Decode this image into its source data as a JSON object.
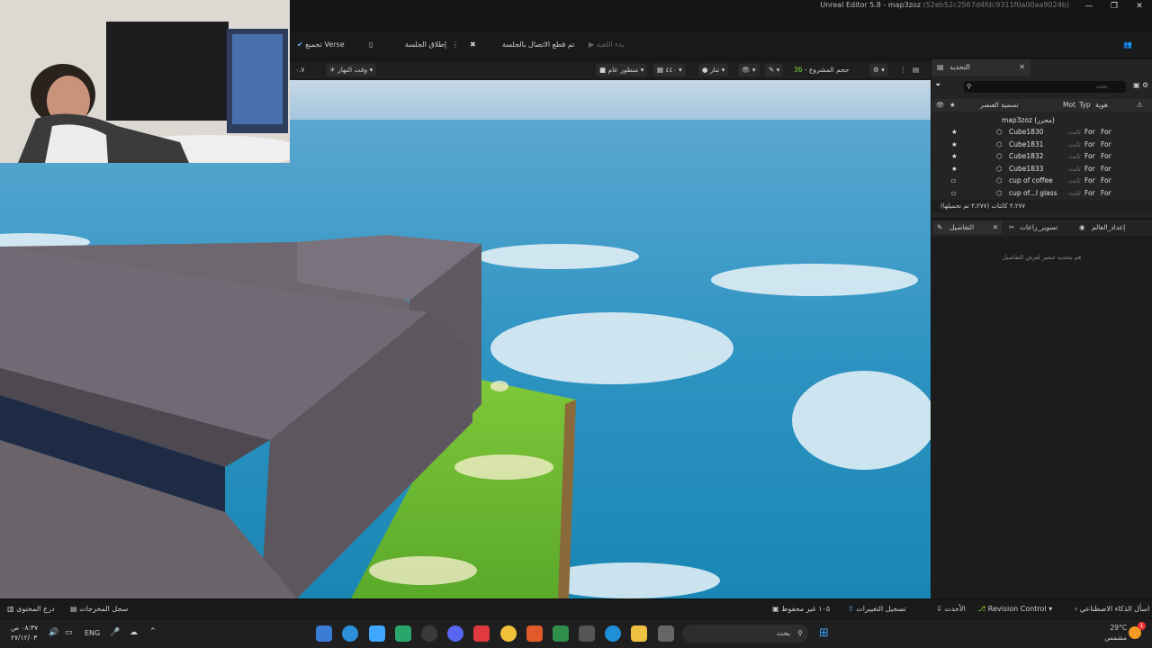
{
  "window": {
    "title": "Unreal Editor 5.8 - map3zoz",
    "guid": "(52eb52c2567d4fdc9311f0a00aa9024b)",
    "minimize": "—",
    "restore": "❐",
    "close": "✕"
  },
  "toolbar": {
    "compile_verse": "تجميع Verse",
    "launch_session": "إطلاق الجلسة",
    "disconnect": "تم قطع الاتصال بالجلسة",
    "start_game": "بدء اللعبة"
  },
  "viewport": {
    "speed_value": "٠.٧",
    "time_of_day": "وقت النهار",
    "perspective": "منظور عام",
    "fov": "٤٤٠",
    "lit": "تنار",
    "scale_label": "حجم المشروع",
    "scale_value": "36"
  },
  "outliner": {
    "tab_title": "التحديد",
    "search_placeholder": "بحث",
    "col_label": "تسمية العنصر",
    "col_type": "Typ",
    "col_mob": "Mot",
    "col_id": "هوية",
    "root": "map3zoz (محرر)",
    "rows": [
      {
        "name": "Cube1830",
        "col1": "ثابت",
        "col2": "For",
        "col3": "For"
      },
      {
        "name": "Cube1831",
        "col1": "ثابت",
        "col2": "For",
        "col3": "For"
      },
      {
        "name": "Cube1832",
        "col1": "ثابت",
        "col2": "For",
        "col3": "For"
      },
      {
        "name": "Cube1833",
        "col1": "ثابت",
        "col2": "For",
        "col3": "For"
      },
      {
        "name": "cup of coffee",
        "col1": "ثابت",
        "col2": "For",
        "col3": "For"
      },
      {
        "name": "cup of...l glass",
        "col1": "ثابت",
        "col2": "For",
        "col3": "For"
      }
    ],
    "footer": "٣،٢٧٧ كائنات (٣،٢٧٧ تم تحميلها)"
  },
  "details": {
    "tab_details": "التفاصيل",
    "tab_settings": "تسوير_زاعات",
    "tab_world": "إعداد_العالم",
    "empty_hint": "قم بتحديد عنصر لعرض التفاصيل"
  },
  "statusbar": {
    "content_drawer": "درج المحتوى",
    "output_log": "سجل المخرجات",
    "unsaved": "١٠٥ غير محفوظ",
    "changes_log": "تسجيل التغييرات",
    "latest": "الأحدث",
    "revision_control": "Revision Control",
    "ask_ai": "اسأل الذكاء الاصطناعي"
  },
  "taskbar": {
    "time": "٠٨:٣٧ ص",
    "date": "٢٧/١٢/٠٣",
    "lang": "ENG",
    "search_placeholder": "بحث",
    "weather_temp": "29°C",
    "weather_desc": "مشمس",
    "notification_count": "1"
  }
}
